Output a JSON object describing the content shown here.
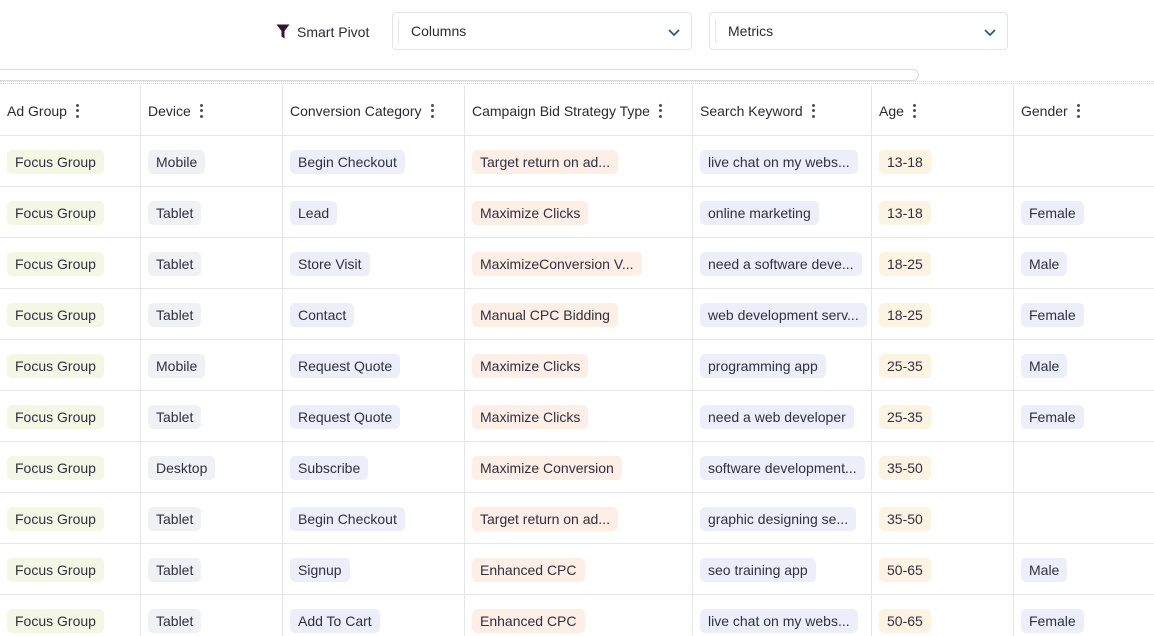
{
  "toolbar": {
    "smart_pivot_label": "Smart Pivot",
    "columns_label": "Columns",
    "metrics_label": "Metrics"
  },
  "colors": {
    "ad_group_chip": "#f3f7e4",
    "device_chip": "#f0f1f4",
    "conversion_chip": "#eceffa",
    "bid_strategy_chip": "#fdeee6",
    "keyword_chip": "#eceffa",
    "age_chip": "#fdf3e2",
    "gender_chip": "#eceffa"
  },
  "table": {
    "headers": [
      "Ad Group",
      "Device",
      "Conversion Category",
      "Campaign Bid Strategy Type",
      "Search Keyword",
      "Age",
      "Gender"
    ],
    "rows": [
      [
        "Focus Group",
        "Mobile",
        "Begin Checkout",
        "Target return on ad...",
        "live chat on my webs...",
        "13-18",
        ""
      ],
      [
        "Focus Group",
        "Tablet",
        "Lead",
        "Maximize Clicks",
        "online marketing",
        "13-18",
        "Female"
      ],
      [
        "Focus Group",
        "Tablet",
        "Store Visit",
        "MaximizeConversion V...",
        "need a software deve...",
        "18-25",
        "Male"
      ],
      [
        "Focus Group",
        "Tablet",
        "Contact",
        "Manual CPC Bidding",
        "web development serv...",
        "18-25",
        "Female"
      ],
      [
        "Focus Group",
        "Mobile",
        "Request Quote",
        "Maximize Clicks",
        "programming app",
        "25-35",
        "Male"
      ],
      [
        "Focus Group",
        "Tablet",
        "Request Quote",
        "Maximize Clicks",
        "need a web developer",
        "25-35",
        "Female"
      ],
      [
        "Focus Group",
        "Desktop",
        "Subscribe",
        "Maximize Conversion",
        "software development...",
        "35-50",
        ""
      ],
      [
        "Focus Group",
        "Tablet",
        "Begin Checkout",
        "Target return on ad...",
        "graphic designing se...",
        "35-50",
        ""
      ],
      [
        "Focus Group",
        "Tablet",
        "Signup",
        "Enhanced CPC",
        "seo training app",
        "50-65",
        "Male"
      ],
      [
        "Focus Group",
        "Tablet",
        "Add To Cart",
        "Enhanced CPC",
        "live chat on my webs...",
        "50-65",
        "Female"
      ]
    ]
  }
}
